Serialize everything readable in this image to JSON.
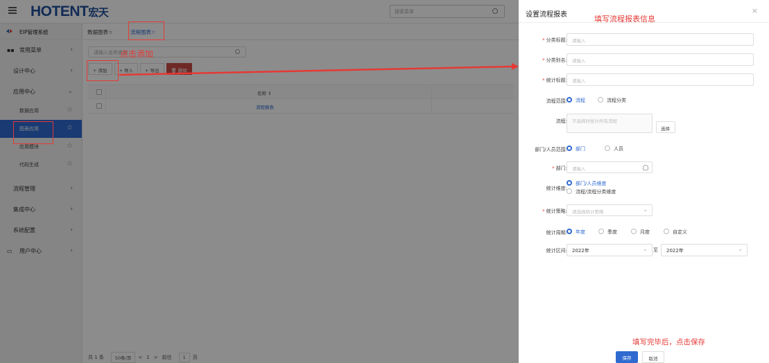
{
  "app": {
    "logo_main": "HOTENT",
    "logo_cn": "宏天",
    "search_placeholder": "搜索菜单"
  },
  "sidebar": {
    "system": "EIP管理系统",
    "items": [
      {
        "label": "常用菜单"
      },
      {
        "label": "设计中心"
      },
      {
        "label": "应用中心"
      }
    ],
    "sub_items": [
      {
        "label": "数据应用"
      },
      {
        "label": "图表应用"
      },
      {
        "label": "应用模块"
      },
      {
        "label": "代码生成"
      }
    ],
    "lower_items": [
      {
        "label": "流程管理"
      },
      {
        "label": "集成中心"
      },
      {
        "label": "系统配置"
      },
      {
        "label": "用户中心"
      }
    ]
  },
  "main": {
    "tabs": [
      {
        "label": "数据图表☆"
      },
      {
        "label": "流程图表☆"
      }
    ],
    "search_placeholder": "请输入名称查询",
    "toolbar": {
      "add": "+ 添加",
      "import": "+ 导入",
      "export": "+ 导出",
      "delete": "🗑 删除"
    },
    "table": {
      "col_name": "名称 ⇕",
      "rows": [
        {
          "name": "流程报表"
        }
      ]
    },
    "pager": {
      "total": "共 1 条",
      "page_size": "50条/页",
      "prev": "<",
      "page": "1",
      "next": ">",
      "goto": "前往",
      "goto_page": "1",
      "page_unit": "页"
    }
  },
  "panel": {
    "title": "设置流程报表",
    "close": "×",
    "fields": {
      "category_title": {
        "label": "分类标题:",
        "placeholder": "请输入"
      },
      "category_alias": {
        "label": "分类别名:",
        "placeholder": "请输入"
      },
      "stat_title": {
        "label": "统计标题:",
        "placeholder": "请输入"
      },
      "flow_scope": {
        "label": "流程范围:",
        "options": [
          "流程",
          "流程分类"
        ],
        "selected": "流程"
      },
      "flow": {
        "label": "流程:",
        "placeholder": "不选择时统计所有流程",
        "button": "选择"
      },
      "org_scope": {
        "label": "部门/人员范围:",
        "options": [
          "部门",
          "人员"
        ],
        "selected": "部门"
      },
      "dept": {
        "label": "部门:",
        "placeholder": "请输入"
      },
      "dimension": {
        "label": "统计维度:",
        "options": [
          "部门/人员维度",
          "流程/流程分类维度"
        ],
        "selected": "部门/人员维度"
      },
      "strategy": {
        "label": "统计策略:",
        "placeholder": "请选择统计策略"
      },
      "period": {
        "label": "统计周期:",
        "options": [
          "年度",
          "季度",
          "月度",
          "自定义"
        ],
        "selected": "年度"
      },
      "range": {
        "label": "统计区间:",
        "from": "2022年",
        "to_label": "至",
        "to": "2022年"
      }
    },
    "save": "保存",
    "cancel": "取消"
  },
  "annotations": {
    "click_add": "点击添加",
    "fill_info": "填写流程报表信息",
    "save_hint": "填写完毕后，点击保存",
    "color": "#e53935"
  }
}
